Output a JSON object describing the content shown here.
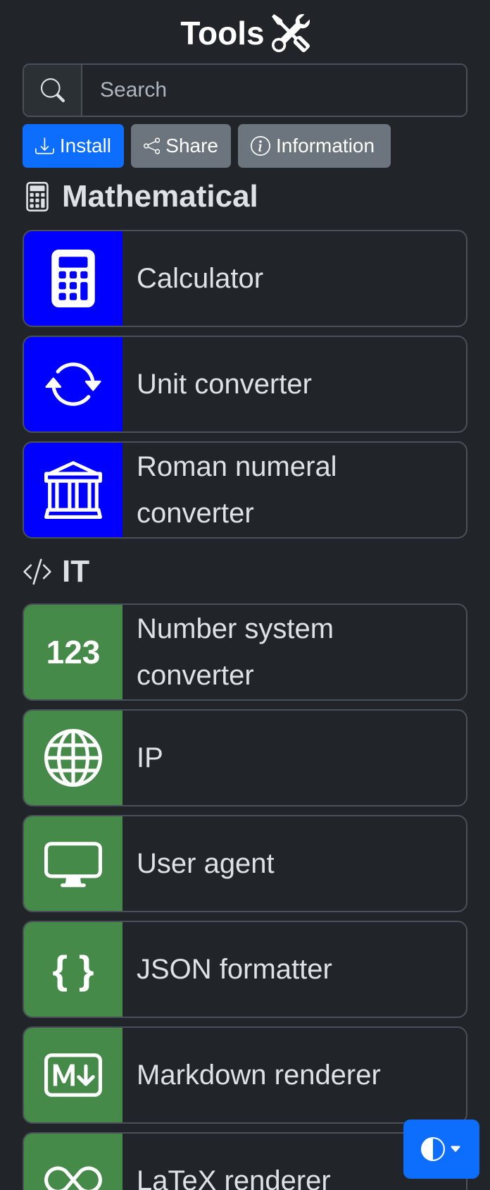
{
  "header": {
    "title": "Tools",
    "icon": "tools-icon"
  },
  "search": {
    "placeholder": "Search",
    "value": ""
  },
  "actions": {
    "install_label": "Install",
    "share_label": "Share",
    "information_label": "Information"
  },
  "sections": [
    {
      "heading": "Mathematical",
      "icon": "calculator-icon",
      "accent": "#0000ff",
      "tools": [
        {
          "label": "Calculator",
          "icon": "calculator-icon"
        },
        {
          "label": "Unit converter",
          "icon": "arrows-cycle-icon"
        },
        {
          "label": "Roman numeral converter",
          "icon": "bank-icon"
        }
      ]
    },
    {
      "heading": "IT",
      "icon": "code-slash-icon",
      "accent": "#458a48",
      "tools": [
        {
          "label": "Number system converter",
          "icon": "123-icon",
          "icon_text": "123"
        },
        {
          "label": "IP",
          "icon": "globe-icon"
        },
        {
          "label": "User agent",
          "icon": "monitor-icon"
        },
        {
          "label": "JSON formatter",
          "icon": "braces-icon",
          "icon_text": "{ }"
        },
        {
          "label": "Markdown renderer",
          "icon": "markdown-icon"
        },
        {
          "label": "LaTeX renderer",
          "icon": "infinity-icon"
        }
      ]
    }
  ],
  "theme_toggle": {
    "icon": "circle-half-icon"
  },
  "colors": {
    "background": "#212529",
    "primary": "#0d6efd",
    "secondary": "#6c757d"
  }
}
